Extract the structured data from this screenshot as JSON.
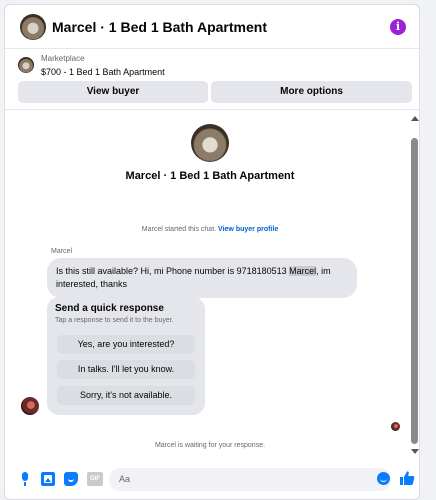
{
  "header": {
    "title": "Marcel · 1 Bed 1 Bath Apartment",
    "info_icon": "i"
  },
  "listing": {
    "source": "Marketplace",
    "price_title": "$700 - 1 Bed 1 Bath Apartment"
  },
  "actions": {
    "view_buyer": "View buyer",
    "more_options": "More options"
  },
  "chat": {
    "title": "Marcel · 1 Bed 1 Bath Apartment",
    "started_text": "Marcel started this chat.",
    "view_profile_link": "View buyer profile",
    "sender_name": "Marcel",
    "message_part1": "Is this still available? Hi, mi Phone number is 9718180513 ",
    "message_highlight": "Marcel",
    "message_part2": ", im interested, thanks",
    "quick_response": {
      "title": "Send a quick response",
      "subtitle": "Tap a response to send it to the buyer.",
      "options": [
        "Yes, are you interested?",
        "In talks. I'll let you know.",
        "Sorry, it's not available."
      ]
    },
    "waiting_text": "Marcel is waiting for your response."
  },
  "composer": {
    "placeholder": "Aa",
    "gif_label": "GIF"
  },
  "colors": {
    "accent": "#0a7cff",
    "info": "#9b22d6",
    "link": "#0064d1",
    "bubble": "#e4e6eb"
  },
  "icons": [
    "info-icon",
    "microphone-icon",
    "photo-icon",
    "sticker-icon",
    "gif-icon",
    "emoji-icon",
    "like-icon"
  ]
}
